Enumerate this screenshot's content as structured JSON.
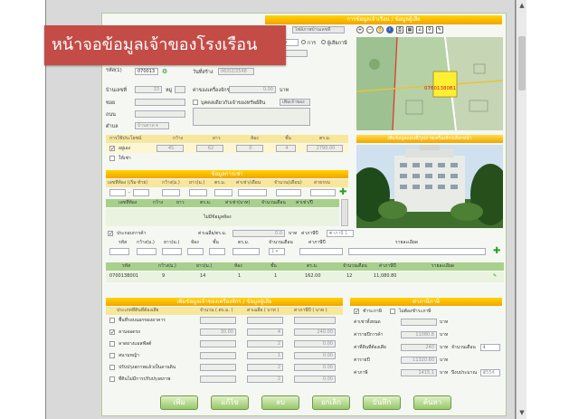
{
  "overlay_title": "หน้าจอข้อมูลเจ้าของโรงเรือน",
  "header": {
    "top_title": "การข้อมูลเจ้าเรือน / ข้อมูลผู้เสีย",
    "upload_button": "ไฟล์ภาพบ้านเลขที่",
    "search_label": "ค้นหา",
    "radio_owner": "การ",
    "radio_tax": "ผู้เสียภาษี"
  },
  "form": {
    "code_label": "รหัส(1)",
    "code_value": "070013",
    "date_label": "วันที่สร้าง",
    "date_value": "06/02/2548",
    "house_no_label": "บ้านเลขที่",
    "house_no_value": "33",
    "moo_label": "หมู่",
    "cost_label": "ค่าของเครื่องจักร",
    "cost_value": "0.00",
    "cost_unit": "บาท",
    "soi_label": "ซอย",
    "same_owner_label": "บุคคลเดียวกับเจ้าของทรัพย์สิน",
    "add_owner_button": "เพิ่มเจ้าของ",
    "road_label": "ถนน",
    "tambon_label": "ตำบล",
    "tambon_value": "บ้านตาด",
    "usage_headers": [
      "การใช้ประโยชน์",
      "กว้าง",
      "ยาว",
      "ห้อง",
      "ชั้น",
      "ตร.ม."
    ],
    "usage_rows": [
      {
        "label": "อยู่เอง",
        "checked": true,
        "values": [
          "45",
          "62",
          "0",
          "4",
          "2790.00"
        ]
      },
      {
        "label": "ให้เช่า",
        "checked": false,
        "values": [
          "",
          "",
          "",
          "",
          ""
        ]
      }
    ]
  },
  "rent_section": {
    "title": "ข้อมูลการเช่า",
    "headers": [
      "เลขที่ห้อง (เริ่ม-ท้าย)",
      "กว้าง(ม.)",
      "ยาว(ม.)",
      "ตร.ม.",
      "ค่าเช่า/เดือน",
      "จำนวน(เดือน)",
      "ค่าธรรม"
    ],
    "sub_headers": [
      "เลขที่ห้อง",
      "กว้าง",
      "ยาว",
      "ตร.ม.",
      "ค่าเช่า(บาท)",
      "จำนวนเดือน",
      "ค่าเช่า/ปี"
    ],
    "empty_text": "ไม่มีข้อมูลห้อง"
  },
  "business_section": {
    "checkbox_label": "ประกอบการค้า",
    "area_label": "ค่าเฉลี่ย/ตร.ม.",
    "area_value": "0.0",
    "unit_label": "บาท",
    "tax_label": "ค่าภาษีปี",
    "tax_value": "ค่าภาษี 1",
    "headers": [
      "รหัส",
      "กว้าง(ม.)",
      "ยาว(ม.)",
      "ห้อง",
      "ชั้น",
      "ตร.ม.",
      "จำนวนเดือน",
      "ค่าภาษีปี",
      "รายละเอียด"
    ],
    "row": [
      "070013B001",
      "9",
      "14",
      "1",
      "1",
      "162.00",
      "12",
      "11,080.80",
      ""
    ]
  },
  "bottom_left": {
    "title": "เพิ่มข้อมูลเจ้าของเครื่องจักร / ข้อมูลผู้เสีย",
    "headers": [
      "ประเภทที่ดินที่ต้องเสีย",
      "จำนวน ( ตร.ม. )",
      "ค่าเฉลี่ย ( บาท )",
      "ค่าภาษีปี ( บาท )"
    ],
    "rows": [
      {
        "label": "พื้นที่รอบนอกของอาคาร",
        "checked": false,
        "values": [
          "",
          "",
          ""
        ]
      },
      {
        "label": "ลานจอดรถ",
        "checked": true,
        "values": [
          "30.00",
          "4",
          "240.00"
        ]
      },
      {
        "label": "ลาดยางแอสฟัลต์",
        "checked": false,
        "values": [
          "",
          "2",
          "0.00"
        ]
      },
      {
        "label": "สนามหญ้า",
        "checked": false,
        "values": [
          "",
          "1",
          "0.00"
        ]
      },
      {
        "label": "ปรับปรุงสภาพแล้วเป็นลานดิน",
        "checked": false,
        "values": [
          "",
          "2",
          "0.00"
        ]
      },
      {
        "label": "ที่ดินไม่มีการปรับปรุงสภาพ",
        "checked": false,
        "values": [
          "",
          "2",
          "0.00"
        ]
      }
    ]
  },
  "bottom_right": {
    "title": "ค่าภาษีภาษี",
    "exempt_label": "ชำระภาษี",
    "exempt_label2": "ไม่ต้องชำระภาษี",
    "rows": [
      {
        "label": "ค่าเช่าทั้งหมด",
        "value": "",
        "unit": "บาท"
      },
      {
        "label": "ค่ารายปีการค้า",
        "value": "11080.8",
        "unit": "บาท"
      },
      {
        "label": "ค่าที่ดินที่ต้องเสีย",
        "value": "240",
        "unit": "บาท",
        "extra": "จำนวนเดือน"
      },
      {
        "label": "ค่ารายปี",
        "value": "11320.80",
        "unit": "บาท"
      },
      {
        "label": "ค่าภาษี",
        "value": "1415.1",
        "unit": "บาท",
        "extra": "ปีงบประมาณ"
      }
    ],
    "month_value": "1",
    "year_value": "2554"
  },
  "photo_bar": "เพิ่มข้อมูลแผนที่/รูปภาพเครื่องจักรเลือกหน้า",
  "map": {
    "label": "07601380B1"
  },
  "buttons": [
    "เพิ่ม",
    "แก้ไข",
    "ลบ",
    "ยกเลิก",
    "บันทึก",
    "ค้นหา"
  ]
}
